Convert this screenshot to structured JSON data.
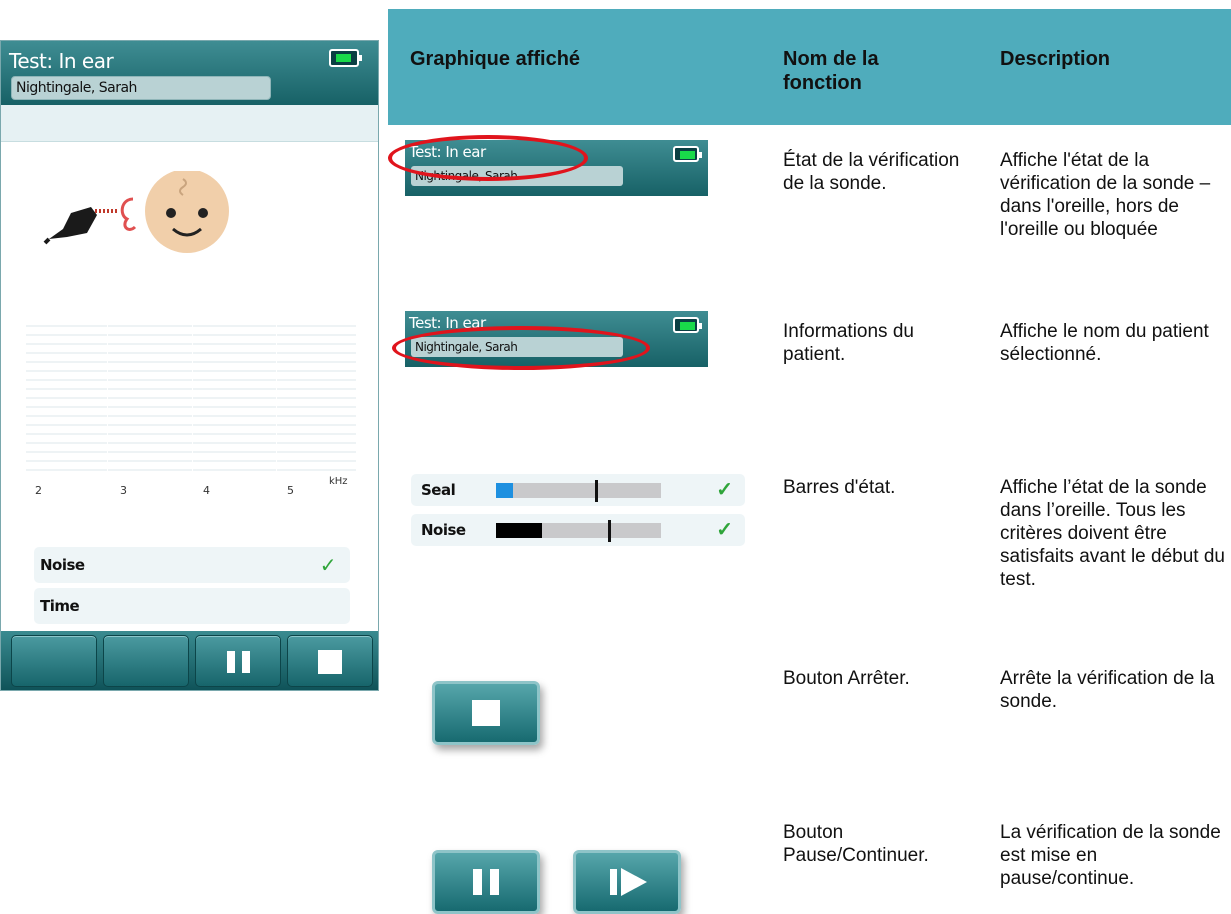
{
  "device": {
    "title": "Test: In ear",
    "patient": "Nightingale, Sarah",
    "graph": {
      "ticks": [
        "2",
        "3",
        "4",
        "5"
      ],
      "unit": "kHz"
    },
    "status_rows": [
      {
        "label": "Noise",
        "checked": true
      },
      {
        "label": "Time",
        "checked": false
      }
    ],
    "footer_buttons": [
      "blank-button-1",
      "blank-button-2",
      "pause-button",
      "stop-button"
    ]
  },
  "table": {
    "headers": [
      "Graphique affiché",
      "Nom de la fonction",
      "Description"
    ],
    "rows": [
      {
        "graphic": {
          "title": "Test: In ear",
          "patient": "Nightingale, Sarah",
          "highlight": "title"
        },
        "name": "État de la vérification de la sonde.",
        "description": "Affiche l'état de la vérification de la sonde – dans l'oreille, hors de l'oreille ou bloquée"
      },
      {
        "graphic": {
          "title": "Test: In ear",
          "patient": "Nightingale, Sarah",
          "highlight": "patient"
        },
        "name": "Informations du patient.",
        "description": "Affiche le nom du patient sélectionné."
      },
      {
        "graphic": {
          "bars": [
            {
              "label": "Seal",
              "fill": 0.1,
              "fill_color": "#1e90e0",
              "marker": 0.6
            },
            {
              "label": "Noise",
              "fill": 0.28,
              "fill_color": "#000000",
              "marker": 0.68
            }
          ]
        },
        "name": "Barres d'état.",
        "description": "Affiche l’état de la sonde dans l’oreille.  Tous les critères doivent être satisfaits avant le début du test."
      },
      {
        "graphic": {
          "button": "stop"
        },
        "name": "Bouton Arrêter.",
        "description": "Arrête la vérification de la sonde."
      },
      {
        "graphic": {
          "buttons": [
            "pause",
            "continue"
          ]
        },
        "name": "Bouton Pause/Continuer.",
        "description": "La vérification de la sonde est mise en pause/continue."
      }
    ]
  },
  "colors": {
    "header_teal": "#176166",
    "table_header": "#4facbc",
    "highlight_red": "#e0141c",
    "check_green": "#2fa53a"
  }
}
